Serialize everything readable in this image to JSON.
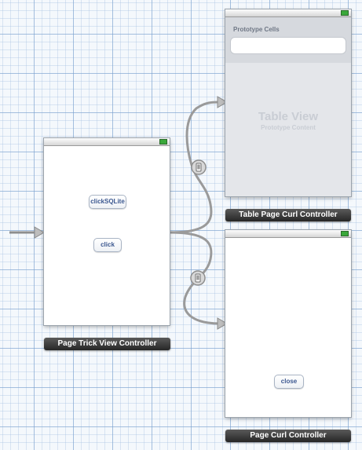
{
  "controllers": {
    "page_trick": {
      "label": "Page Trick View Controller",
      "buttons": {
        "click_sqlite": "clickSQLite",
        "click": "click"
      }
    },
    "table_page_curl": {
      "label": "Table Page Curl Controller",
      "prototype_cells_title": "Prototype Cells",
      "table_view_title": "Table View",
      "table_view_subtitle": "Prototype Content"
    },
    "page_curl": {
      "label": "Page Curl Controller",
      "buttons": {
        "close": "close"
      }
    }
  },
  "segues": {
    "style": "modal",
    "icon": "modal-segue-icon"
  }
}
